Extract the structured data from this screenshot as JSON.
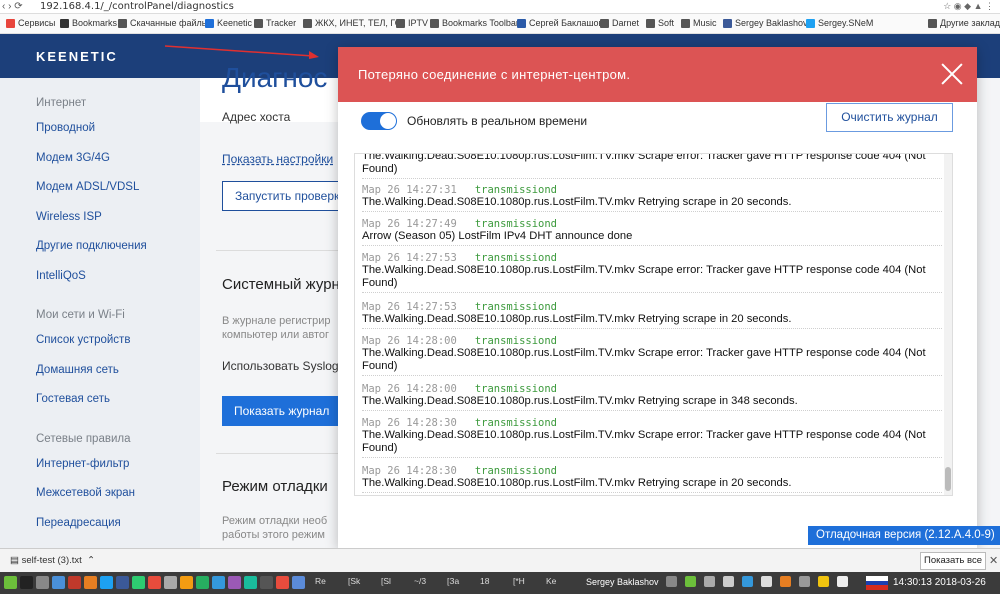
{
  "browser": {
    "url": "192.168.4.1/_/controlPanel/diagnostics",
    "bookmarks": [
      {
        "label": "Сервисы",
        "color": "#e8453c"
      },
      {
        "label": "Bookmarks",
        "color": "#333333"
      },
      {
        "label": "Скачанные файлы",
        "color": "#555555"
      },
      {
        "label": "Keenetic",
        "color": "#1e6fd9"
      },
      {
        "label": "Tracker",
        "color": "#555555"
      },
      {
        "label": "ЖКХ, ИНЕТ, ТЕЛ, ГО",
        "color": "#555555"
      },
      {
        "label": "IPTV",
        "color": "#555555"
      },
      {
        "label": "Bookmarks Toolbar",
        "color": "#555555"
      },
      {
        "label": "Сергей Баклашов",
        "color": "#2a5aa8"
      },
      {
        "label": "Darnet",
        "color": "#555555"
      },
      {
        "label": "Soft",
        "color": "#555555"
      },
      {
        "label": "Music",
        "color": "#555555"
      },
      {
        "label": "Sergey Baklashov",
        "color": "#3b5998"
      },
      {
        "label": "Sergey.SNeM",
        "color": "#1da1f2"
      },
      {
        "label": "Другие закладки",
        "color": "#555555"
      }
    ]
  },
  "app": {
    "logo": "KEENETIC"
  },
  "sidebar": {
    "groups": [
      {
        "title": "Интернет",
        "items": [
          "Проводной",
          "Модем 3G/4G",
          "Модем ADSL/VDSL",
          "Wireless ISP",
          "Другие подключения",
          "IntelliQoS"
        ]
      },
      {
        "title": "Мои сети и Wi-Fi",
        "items": [
          "Список устройств",
          "Домашняя сеть",
          "Гостевая сеть"
        ]
      },
      {
        "title": "Сетевые правила",
        "items": [
          "Интернет-фильтр",
          "Межсетевой экран",
          "Переадресация"
        ]
      }
    ]
  },
  "main": {
    "title": "Диагнос",
    "host_label": "Адрес хоста",
    "show_settings": "Показать настройки",
    "run_check": "Запустить проверк",
    "syslog_heading": "Системный журн",
    "syslog_desc_1": "В журнале регистрир",
    "syslog_desc_2": "компьютер или автог",
    "use_syslog": "Использовать Syslog",
    "show_log_button": "Показать журнал",
    "debug_heading": "Режим отладки",
    "debug_desc_1": "Режим отладки необ",
    "debug_desc_2": "работы этого режим"
  },
  "modal": {
    "alert": "Потеряно соединение с интернет-центром.",
    "realtime_label": "Обновлять в реальном времени",
    "realtime_on": true,
    "clear_button": "Очистить журнал",
    "log": [
      {
        "ts": "",
        "src": "",
        "text": "The.Walking.Dead.S08E10.1080p.rus.LostFilm.TV.mkv Scrape error: Tracker gave HTTP response code 404 (Not Found)"
      },
      {
        "ts": "Мар 26 14:27:31",
        "src": "transmissiond",
        "text": "The.Walking.Dead.S08E10.1080p.rus.LostFilm.TV.mkv Retrying scrape in 20 seconds."
      },
      {
        "ts": "Мар 26 14:27:49",
        "src": "transmissiond",
        "text": "Arrow (Season 05) LostFilm IPv4 DHT announce done"
      },
      {
        "ts": "Мар 26 14:27:53",
        "src": "transmissiond",
        "text": "The.Walking.Dead.S08E10.1080p.rus.LostFilm.TV.mkv Scrape error: Tracker gave HTTP response code 404 (Not Found)"
      },
      {
        "ts": "Мар 26 14:27:53",
        "src": "transmissiond",
        "text": "The.Walking.Dead.S08E10.1080p.rus.LostFilm.TV.mkv Retrying scrape in 20 seconds."
      },
      {
        "ts": "Мар 26 14:28:00",
        "src": "transmissiond",
        "text": "The.Walking.Dead.S08E10.1080p.rus.LostFilm.TV.mkv Scrape error: Tracker gave HTTP response code 404 (Not Found)"
      },
      {
        "ts": "Мар 26 14:28:00",
        "src": "transmissiond",
        "text": "The.Walking.Dead.S08E10.1080p.rus.LostFilm.TV.mkv Retrying scrape in 348 seconds."
      },
      {
        "ts": "Мар 26 14:28:30",
        "src": "transmissiond",
        "text": "The.Walking.Dead.S08E10.1080p.rus.LostFilm.TV.mkv Scrape error: Tracker gave HTTP response code 404 (Not Found)"
      },
      {
        "ts": "Мар 26 14:28:30",
        "src": "transmissiond",
        "text": "The.Walking.Dead.S08E10.1080p.rus.LostFilm.TV.mkv Retrying scrape in 20 seconds."
      }
    ]
  },
  "debug_version": "Отладочная версия (2.12.A.4.0-9)",
  "downloads": {
    "file": "self-test (3).txt",
    "show_all": "Показать все"
  },
  "taskbar": {
    "windows": [
      "Re",
      "[Sk",
      "[Sl",
      "~/3",
      "[За",
      "18",
      "[*Н",
      "Ke"
    ],
    "user": "Sergey Baklashov",
    "clock": "14:30:13  2018-03-26"
  },
  "colors": {
    "header": "#1c3f7a",
    "accent": "#1e6fd9",
    "alert": "#dc5454",
    "log_source": "#3c9a3c"
  }
}
